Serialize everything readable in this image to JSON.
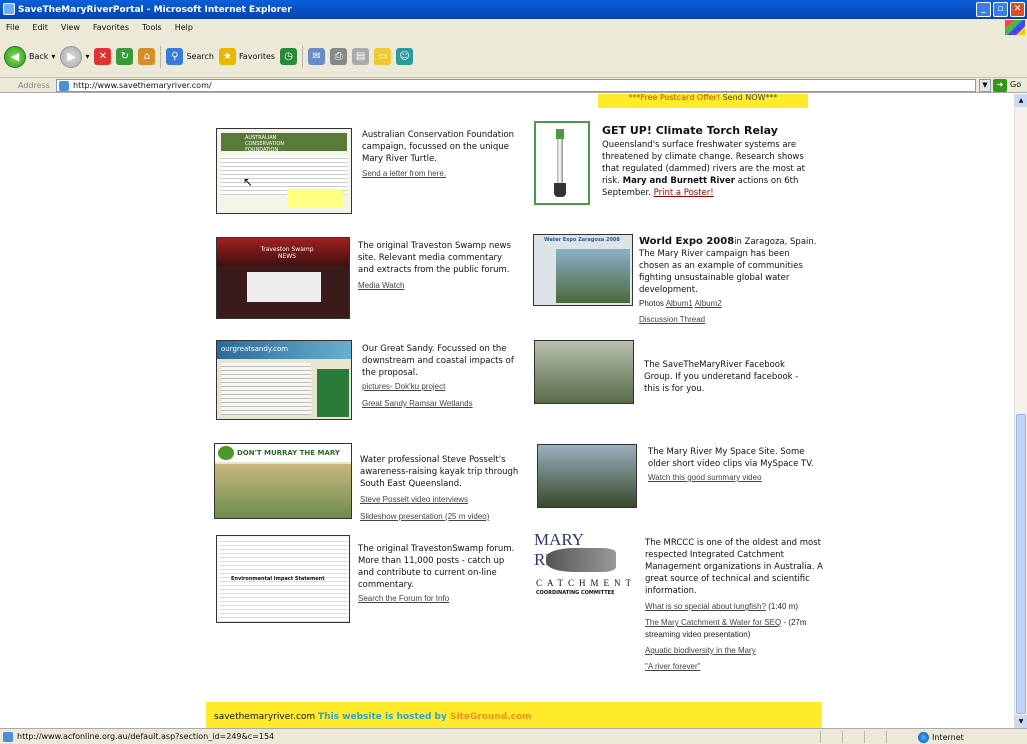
{
  "window": {
    "title": "SaveTheMaryRiverPortal - Microsoft Internet Explorer"
  },
  "menu": [
    "File",
    "Edit",
    "View",
    "Favorites",
    "Tools",
    "Help"
  ],
  "toolbar": {
    "back": "Back",
    "search": "Search",
    "favorites": "Favorites"
  },
  "address": {
    "label": "Address",
    "url": "http://www.savethemaryriver.com/",
    "go": "Go"
  },
  "top_banner": {
    "link": "***Free Postcard Offer!",
    "rest": " Send NOW***"
  },
  "left": [
    {
      "img_title": "AUSTRALIAN CONSERVATION FOUNDATION",
      "text": "Australian Conservation Foundation campaign, focussed on the unique Mary River Turtle.",
      "links": [
        "Send a letter from here."
      ]
    },
    {
      "img_title": "Traveston Swamp NEWS",
      "text": "The original Traveston Swamp news site. Relevant media commentary and extracts from the public forum.",
      "links": [
        "Media Watch"
      ]
    },
    {
      "img_title": "ourgreatsandy.com",
      "text": "Our Great Sandy. Focussed on the downstream and coastal impacts of the proposal.",
      "links": [
        "pictures- Dok'ku project",
        "Great Sandy Ramsar Wetlands"
      ]
    },
    {
      "img_title": "DON'T MURRAY THE MARY",
      "text": "Water professional Steve Posselt's awareness-raising kayak trip through South East Queensland.",
      "links": [
        "Steve Posselt video interviews",
        "Slideshow presentation (25 m video)"
      ]
    },
    {
      "img_title": "Environmental Impact Statement",
      "text": "The original TravestonSwamp forum. More than 11,000 posts - catch up and contribute to current on-line commentary.",
      "links": [
        "Search the Forum for Info"
      ]
    }
  ],
  "right": [
    {
      "title": "GET UP! Climate Torch Relay",
      "text": "Queensland's surface freshwater systems are threatened by climate change. Research shows that regulated (dammed) rivers are the most at risk.",
      "bold": "Mary and Burnett River",
      "text2": "actions on 6th September.",
      "link": "Print a Poster!"
    },
    {
      "img_title": "Water Expo Zaragoza 2008",
      "title": "World Expo 2008",
      "title_rest": "in Zaragoza, Spain.",
      "text": "The Mary River campaign has been chosen as an example of communities fighting unsustainable global water development.",
      "photos_label": "Photos",
      "links": [
        "Album1",
        "Album2",
        "Discussion Thread"
      ]
    },
    {
      "text": "The SaveTheMaryRiver Facebook Group. If you underetand facebook - this is for you."
    },
    {
      "text": "The Mary River My Space Site. Some older short video clips via MySpace TV.",
      "links": [
        "Watch this good summary video"
      ]
    },
    {
      "logo_title": "MARY RIVER",
      "logo_sub1": "CATCHMENT",
      "logo_sub2": "COORDINATING COMMITTEE",
      "text": "The MRCCC is one of the oldest and most respected Integrated Catchment Management organizations in Australia. A great source of technical and scientific information.",
      "links": [
        "What is so special about lungfish?",
        "The Mary Catchment & Water for SEQ",
        "Aquatic biodiversity in the Mary",
        "\"A river forever\""
      ],
      "notes": [
        " (1:40 m)",
        " - (27m streaming video presentation)"
      ]
    }
  ],
  "footer": {
    "site": "savethemaryriver.com",
    "host": "This website is hosted by ",
    "sg": "SiteGround.com"
  },
  "status": {
    "url": "http://www.acfonline.org.au/default.asp?section_id=249&c=154",
    "zone": "Internet"
  }
}
